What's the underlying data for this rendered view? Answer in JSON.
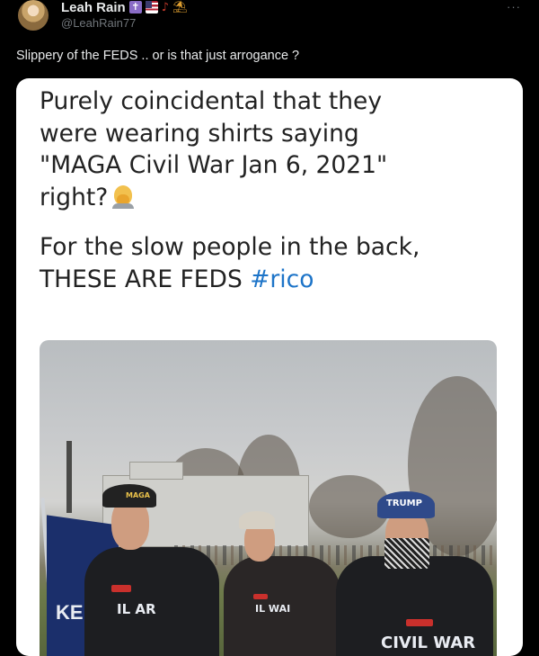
{
  "author": {
    "display_name": "Leah Rain",
    "handle": "@LeahRain77",
    "badges": [
      "cross-emoji",
      "us-flag-emoji",
      "guitar-emoji",
      "island-emoji"
    ]
  },
  "more_label": "···",
  "tweet": {
    "text": "Slippery of the FEDS .. or is that just arrogance ?"
  },
  "screenshot": {
    "lines": [
      "Purely coincidental that they",
      "were wearing shirts saying",
      "\"MAGA Civil War Jan 6, 2021\"",
      "right?"
    ],
    "lines2_prefix": "For the slow people in the back,",
    "line3_prefix": "THESE ARE FEDS ",
    "hashtag": "#rico",
    "facepalm_icon": "person-facepalming-emoji",
    "hashtag_color": "#1d74c8"
  },
  "photo": {
    "flag_text": "KE",
    "cap_left": "MAGA",
    "cap_right": "TRUMP",
    "shirt_left": "IL AR",
    "shirt_middle": "IL WAI",
    "shirt_right": "CIVIL WAR"
  }
}
